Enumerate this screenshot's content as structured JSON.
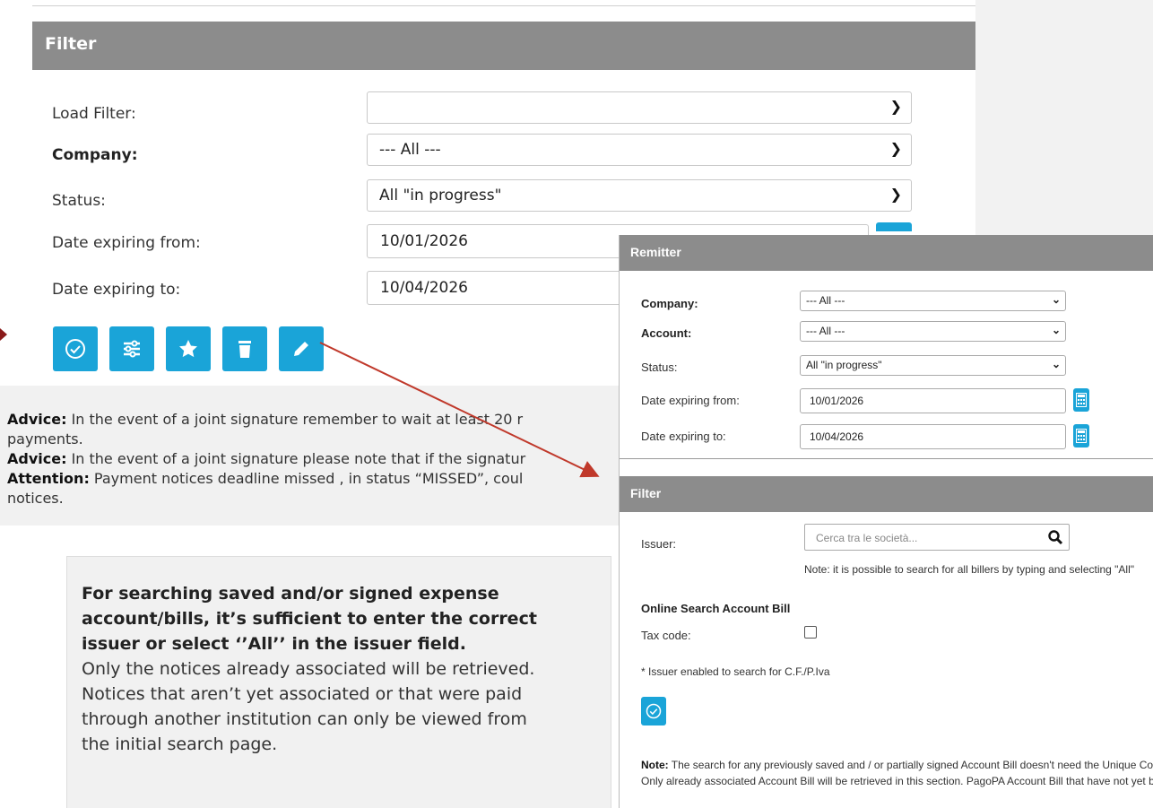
{
  "filter_panel": {
    "title": "Filter",
    "fields": {
      "load_filter_label": "Load Filter:",
      "load_filter_value": "",
      "company_label": "Company:",
      "company_value": "--- All ---",
      "status_label": "Status:",
      "status_value": "All \"in progress\"",
      "date_from_label": "Date expiring from:",
      "date_from_value": "10/01/2026",
      "date_to_label": "Date expiring to:",
      "date_to_value": "10/04/2026"
    },
    "buttons": [
      "check-icon",
      "sliders-icon",
      "star-icon",
      "trash-icon",
      "pencil-icon"
    ]
  },
  "advice": {
    "line1_label": "Advice:",
    "line1_text": " In the event of a joint signature remember to wait at least 20 r",
    "line2_text": "payments.",
    "line3_label": "Advice:",
    "line3_text": " In the event of a joint signature please note that if the signatur",
    "line4_label": "Attention:",
    "line4_text": " Payment notices deadline missed , in status “MISSED”, coul",
    "line5_text": "notices."
  },
  "info_box": {
    "bold_lines": [
      "For searching saved and/or signed expense",
      "account/bills, it’s sufficient to enter the correct",
      "issuer or select ‘’All’’ in the issuer field."
    ],
    "lines": [
      "Only the notices already associated will be retrieved.",
      "Notices that aren’t yet associated or that were paid",
      "through another institution can only be viewed from",
      "the initial search page."
    ]
  },
  "overlay": {
    "remitter_title": "Remitter",
    "company_label": "Company:",
    "company_value": "--- All ---",
    "account_label": "Account:",
    "account_value": "--- All ---",
    "status_label": "Status:",
    "status_value": "All \"in progress\"",
    "date_from_label": "Date expiring from:",
    "date_from_value": "10/01/2026",
    "date_to_label": "Date expiring to:",
    "date_to_value": "10/04/2026",
    "filter_title": "Filter",
    "issuer_label": "Issuer:",
    "issuer_placeholder": "Cerca tra le società...",
    "issuer_note": "Note: it is possible to search for all billers by typing and selecting \"All\"",
    "online_search_title": "Online Search Account Bill",
    "tax_code_label": "Tax code:",
    "enabled_note": "* Issuer enabled to search for C.F./P.Iva",
    "note_label": "Note:",
    "note_line1": " The search for any previously saved and / or partially signed Account Bill doesn't need the Unique Code; just e",
    "note_line2": "Only already associated Account Bill will be retrieved in this section. PagoPA Account Bill that have not yet been ass"
  },
  "colors": {
    "header_gray": "#8c8c8c",
    "button_blue": "#1aa4d8",
    "arrow_red": "#c0392b",
    "panel_gray": "#f1f1f1"
  }
}
